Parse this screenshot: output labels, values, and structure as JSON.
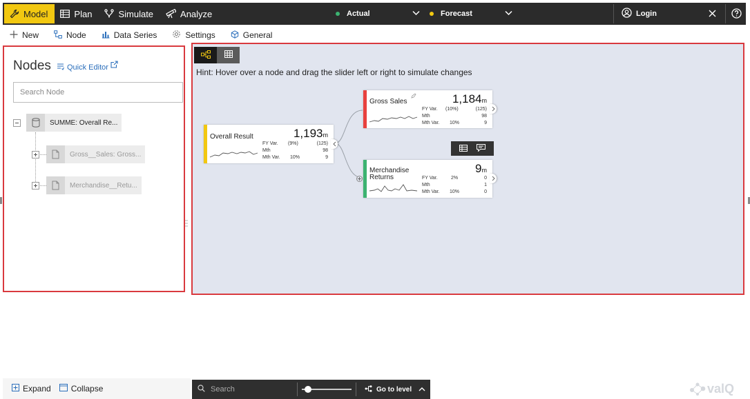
{
  "topbar": {
    "modes": [
      {
        "label": "Model",
        "icon": "wrench-icon",
        "active": true
      },
      {
        "label": "Plan",
        "icon": "table-icon",
        "active": false
      },
      {
        "label": "Simulate",
        "icon": "branch-icon",
        "active": false
      },
      {
        "label": "Analyze",
        "icon": "telescope-icon",
        "active": false
      }
    ],
    "actual": {
      "label": "Actual",
      "color": "#3cb371"
    },
    "forecast": {
      "label": "Forecast",
      "color": "#f2c811"
    },
    "login": "Login"
  },
  "toolbar": {
    "new": "New",
    "node": "Node",
    "data_series": "Data Series",
    "settings": "Settings",
    "general": "General"
  },
  "left_panel": {
    "title": "Nodes",
    "quick_editor": "Quick Editor",
    "search_placeholder": "Search Node",
    "tree": [
      {
        "label": "SUMME: Overall Re...",
        "icon": "database-icon"
      },
      {
        "label": "Gross__Sales: Gross...",
        "icon": "document-icon"
      },
      {
        "label": "Merchandise__Retu...",
        "icon": "document-icon"
      }
    ],
    "expand": "Expand",
    "collapse": "Collapse"
  },
  "canvas": {
    "hint": "Hint: Hover over a node and drag the slider left or right to simulate changes",
    "nodes": {
      "overall": {
        "name": "Overall Result",
        "value": "1,193",
        "unit": "m",
        "color": "#f2c811",
        "fy_label": "FY Var.",
        "fy_pct": "(9%)",
        "fy_abs": "(125)",
        "mth_label": "Mth",
        "mth_abs": "98",
        "mthvar_label": "Mth Var.",
        "mthvar_pct": "10%",
        "mthvar_abs": "9"
      },
      "gross": {
        "name": "Gross Sales",
        "value": "1,184",
        "unit": "m",
        "color": "#e8413e",
        "fy_label": "FY Var.",
        "fy_pct": "(10%)",
        "fy_abs": "(125)",
        "mth_label": "Mth",
        "mth_abs": "98",
        "mthvar_label": "Mth Var.",
        "mthvar_pct": "10%",
        "mthvar_abs": "9"
      },
      "merch": {
        "name1": "Merchandise",
        "name2": "Returns",
        "value": "9",
        "unit": "m",
        "color": "#3cb371",
        "fy_label": "FY Var.",
        "fy_pct": "2%",
        "fy_abs": "0",
        "mth_label": "Mth",
        "mth_abs": "1",
        "mthvar_label": "Mth Var.",
        "mthvar_pct": "10%",
        "mthvar_abs": "0"
      }
    }
  },
  "bottombar": {
    "search": "Search",
    "goto": "Go to level"
  },
  "logo": "valQ"
}
